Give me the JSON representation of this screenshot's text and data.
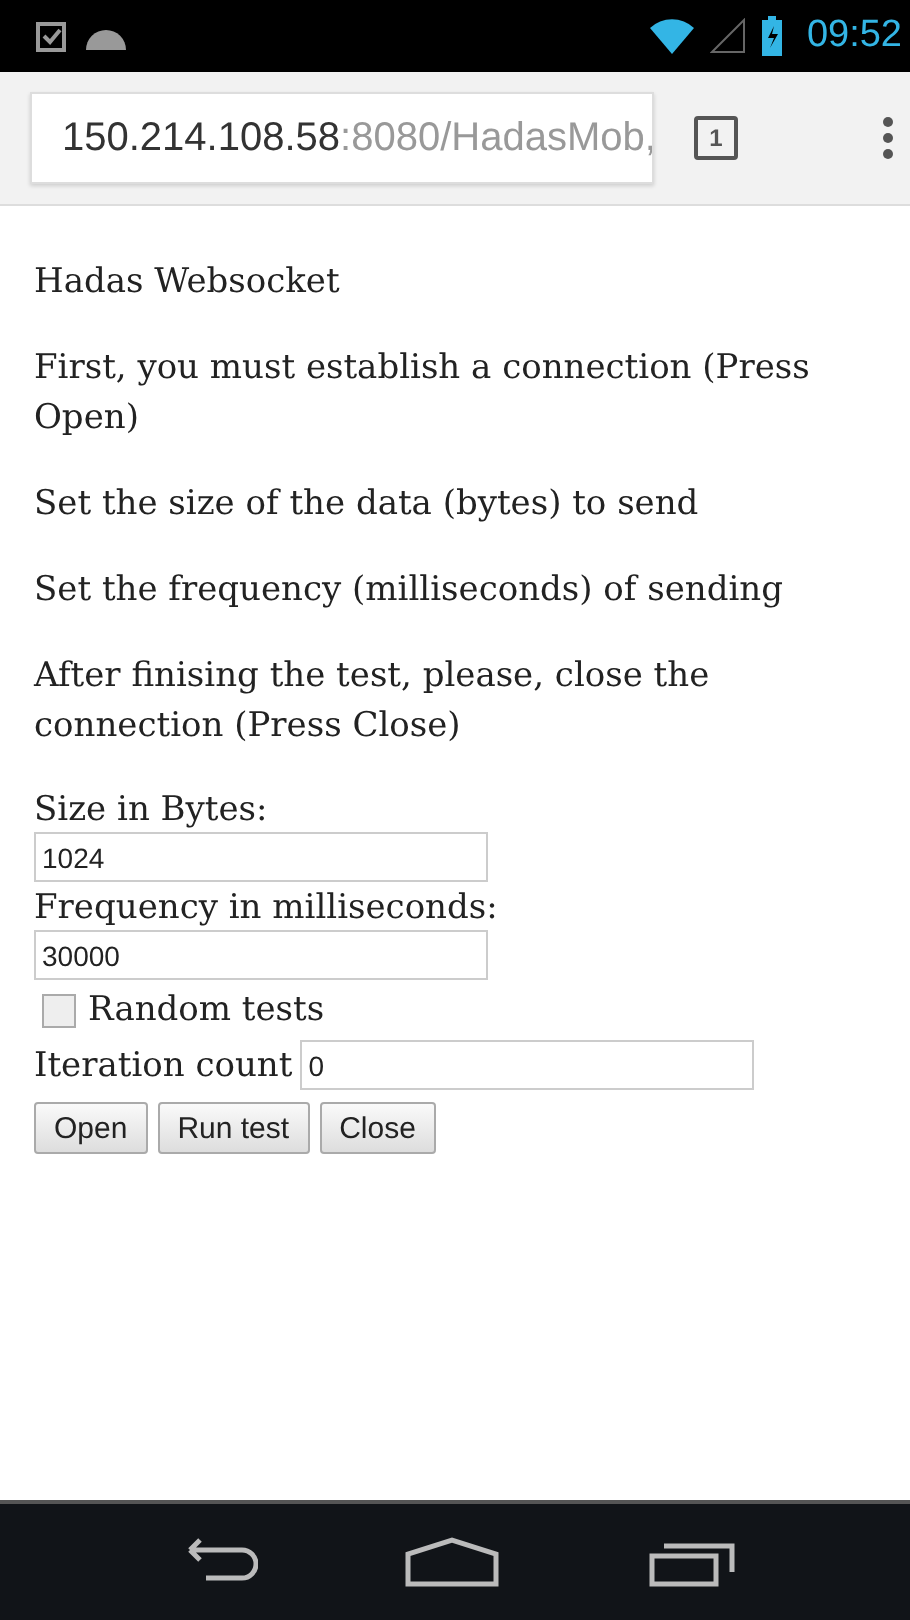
{
  "status_bar": {
    "time": "09:52"
  },
  "address_bar": {
    "host": "150.214.108.58",
    "path": ":8080/HadasMob,",
    "tab_count": "1"
  },
  "page": {
    "title": "Hadas Websocket",
    "paragraphs": [
      "First, you must establish a connection (Press Open)",
      "Set the size of the data (bytes) to send",
      "Set the frequency (milliseconds) of sending",
      "After finising the test, please, close the connection (Press Close)"
    ],
    "size_label": "Size in Bytes:",
    "size_value": "1024",
    "frequency_label": "Frequency in milliseconds:",
    "frequency_value": "30000",
    "random_tests": {
      "label": "Random tests",
      "checked": false
    },
    "iteration_label": "Iteration count",
    "iteration_value": "0",
    "buttons": [
      "Open",
      "Run test",
      "Close"
    ]
  }
}
